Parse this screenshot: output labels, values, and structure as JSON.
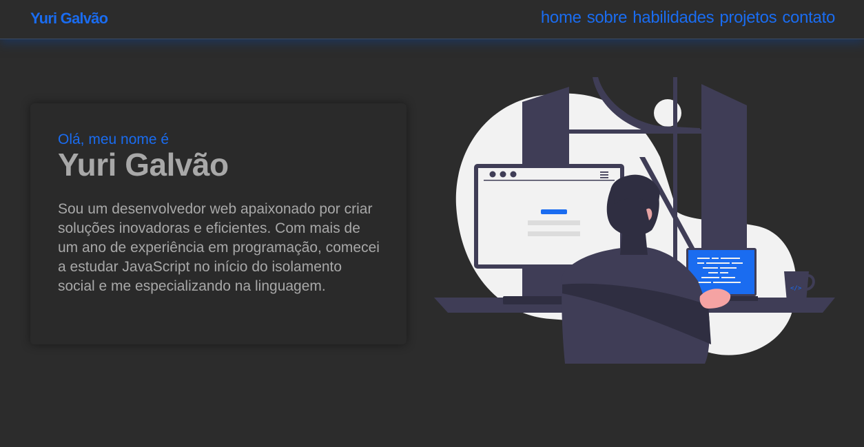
{
  "header": {
    "brand": "Yuri Galvão",
    "nav": [
      "home",
      "sobre",
      "habilidades",
      "projetos",
      "contato"
    ]
  },
  "hero": {
    "greeting": "Olá, meu nome é",
    "name": "Yuri Galvão",
    "bio": "Sou um desenvolvedor web apaixonado por criar soluções inovadoras e eficientes. Com mais de um ano de experiência em programação, comecei a estudar JavaScript no início do isolamento social e me especializando na linguagem."
  },
  "colors": {
    "background": "#2c2c2c",
    "accent": "#1a6cf0",
    "text": "#a8a8a8",
    "illustration_dark": "#3f3d56",
    "illustration_light": "#f2f2f2"
  }
}
